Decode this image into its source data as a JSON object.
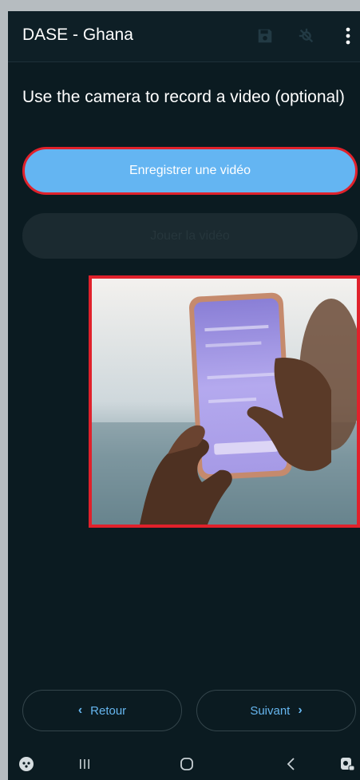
{
  "app": {
    "title": "DASE - Ghana",
    "icons": [
      "save-icon",
      "gps-icon",
      "more-vert-icon"
    ]
  },
  "question": {
    "label": "Use the camera to record a video (optional)"
  },
  "actions": {
    "record_label": "Enregistrer une vidéo",
    "play_label": "Jouer la vidéo"
  },
  "navigation": {
    "back_label": "Retour",
    "next_label": "Suivant"
  },
  "system_nav": {
    "icons": [
      "game-launcher-icon",
      "recent-apps-icon",
      "home-icon",
      "back-icon",
      "assistant-icon"
    ]
  },
  "colors": {
    "background": "#0b1b21",
    "accent": "#64b5f2",
    "highlight_border": "#e0212b",
    "nav_text": "#66b6ef"
  }
}
